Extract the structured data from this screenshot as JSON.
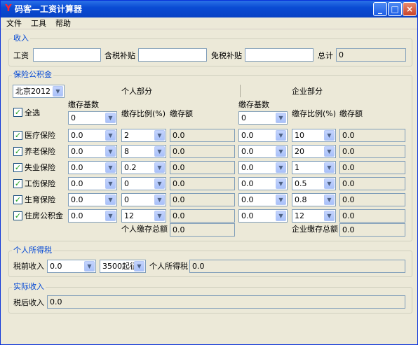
{
  "window": {
    "title": "码客—工资计算器",
    "icon": "app-y-icon",
    "minimize_glyph": "_",
    "maximize_glyph": "□",
    "close_glyph": "×"
  },
  "menu": [
    "文件",
    "工具",
    "帮助"
  ],
  "income": {
    "group_title": "收入",
    "salary_label": "工资",
    "salary_value": "",
    "taxable_allowance_label": "含税补贴",
    "taxable_allowance_value": "",
    "taxfree_allowance_label": "免税补贴",
    "taxfree_allowance_value": "",
    "total_label": "总计",
    "total_value": "0"
  },
  "insurance": {
    "group_title": "保险公积金",
    "city": "北京2012",
    "personal_title": "个人部分",
    "company_title": "企业部分",
    "select_all_label": "全选",
    "header_base": "缴存基数",
    "header_ratio": "缴存比例(%)",
    "header_amount": "缴存额",
    "personal_base_all": "0",
    "company_base_all": "0",
    "rows": [
      {
        "name": "医疗保险",
        "p_base": "0.0",
        "p_ratio": "2",
        "p_amount": "0.0",
        "c_base": "0.0",
        "c_ratio": "10",
        "c_amount": "0.0"
      },
      {
        "name": "养老保险",
        "p_base": "0.0",
        "p_ratio": "8",
        "p_amount": "0.0",
        "c_base": "0.0",
        "c_ratio": "20",
        "c_amount": "0.0"
      },
      {
        "name": "失业保险",
        "p_base": "0.0",
        "p_ratio": "0.2",
        "p_amount": "0.0",
        "c_base": "0.0",
        "c_ratio": "1",
        "c_amount": "0.0"
      },
      {
        "name": "工伤保险",
        "p_base": "0.0",
        "p_ratio": "0",
        "p_amount": "0.0",
        "c_base": "0.0",
        "c_ratio": "0.5",
        "c_amount": "0.0"
      },
      {
        "name": "生育保险",
        "p_base": "0.0",
        "p_ratio": "0",
        "p_amount": "0.0",
        "c_base": "0.0",
        "c_ratio": "0.8",
        "c_amount": "0.0"
      },
      {
        "name": "住房公积金",
        "p_base": "0.0",
        "p_ratio": "12",
        "p_amount": "0.0",
        "c_base": "0.0",
        "c_ratio": "12",
        "c_amount": "0.0"
      }
    ],
    "personal_total_label": "个人缴存总额",
    "personal_total_value": "0.0",
    "company_total_label": "企业缴存总额",
    "company_total_value": "0.0"
  },
  "tax": {
    "group_title": "个人所得税",
    "pretax_label": "税前收入",
    "pretax_value": "0.0",
    "threshold": "3500起征",
    "tax_label": "个人所得税",
    "tax_value": "0.0"
  },
  "actual": {
    "group_title": "实际收入",
    "aftertax_label": "税后收入",
    "aftertax_value": "0.0"
  },
  "colors": {
    "title_bar": "#0a4bd4",
    "group_title": "#0046d5",
    "window_bg": "#ece9d8",
    "check": "#21a121"
  }
}
